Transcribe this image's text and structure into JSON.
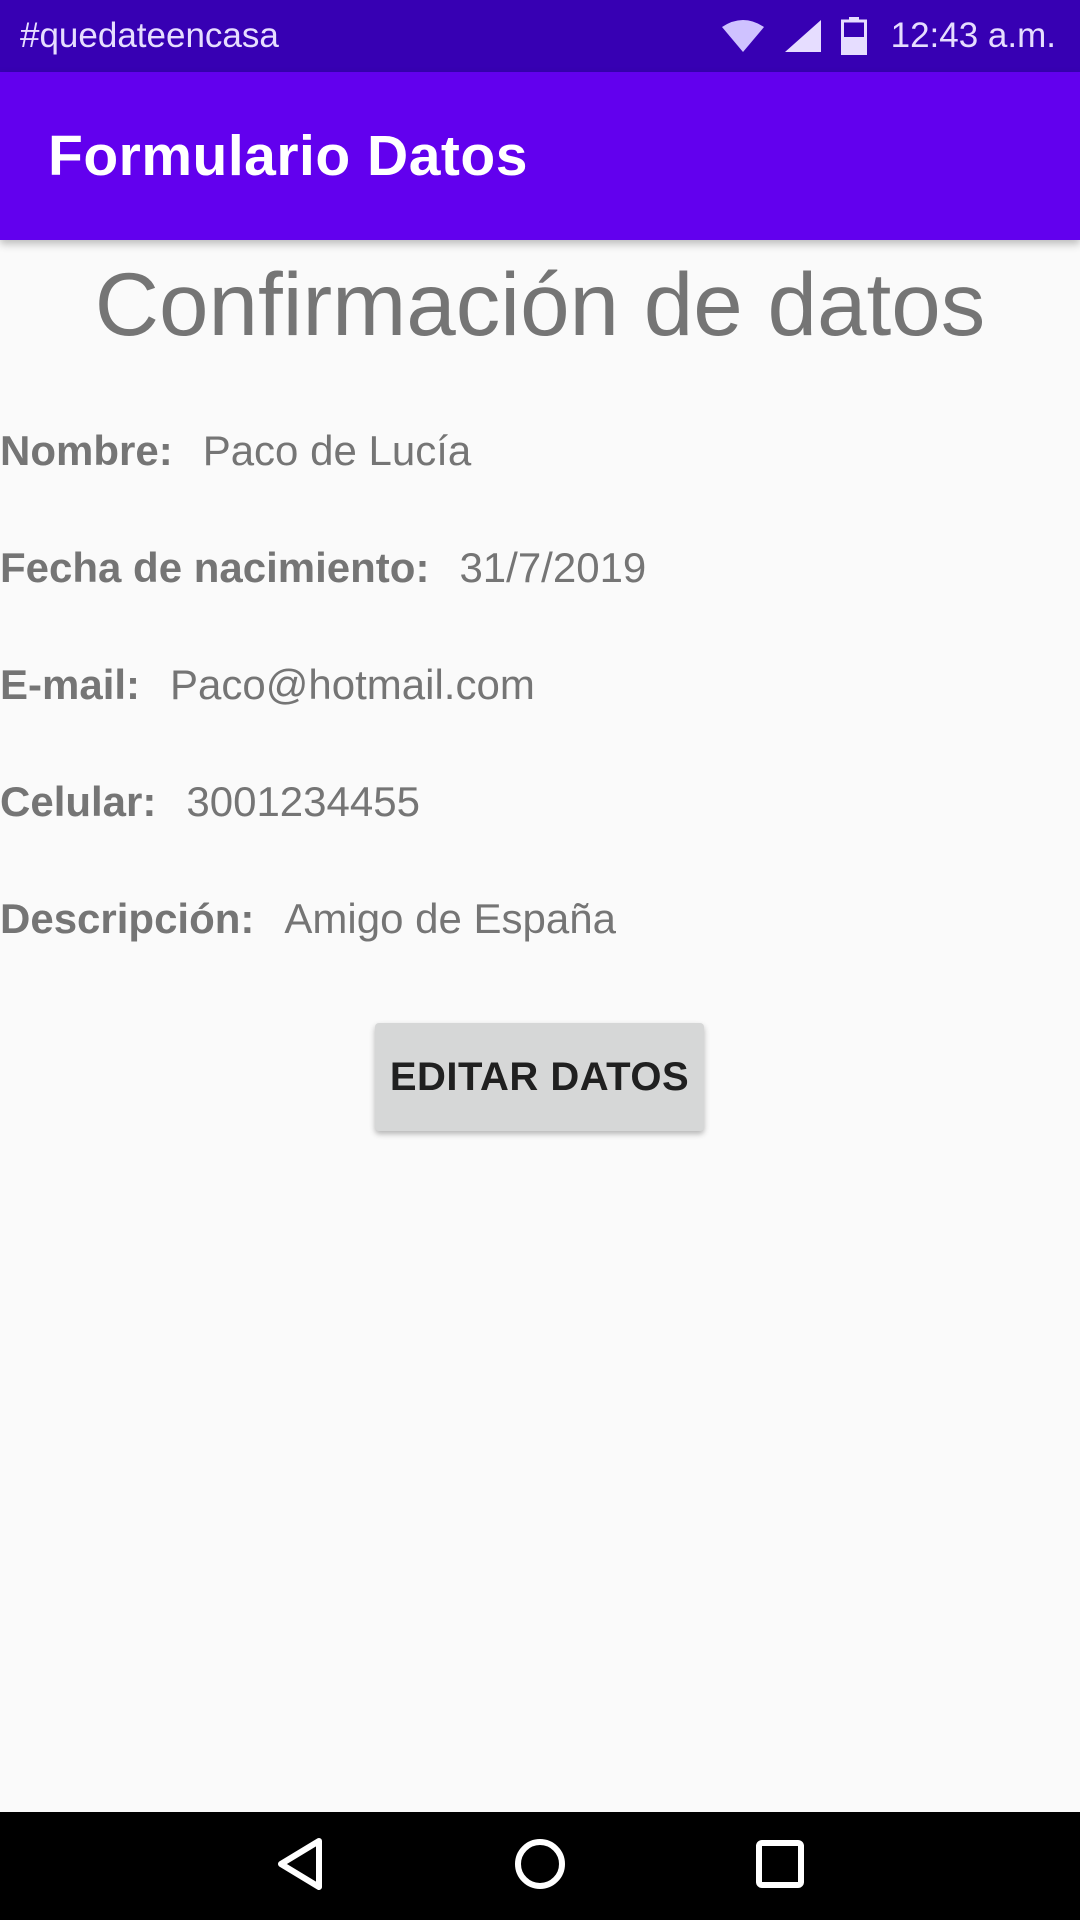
{
  "status_bar": {
    "notification_text": "#quedateencasa",
    "time": "12:43 a.m.",
    "icons": [
      "wifi-icon",
      "cell-signal-icon",
      "battery-icon"
    ]
  },
  "app_bar": {
    "title": "Formulario Datos"
  },
  "content": {
    "heading": "Confirmación de datos",
    "fields": [
      {
        "label": "Nombre:",
        "value": "Paco de Lucía"
      },
      {
        "label": "Fecha de nacimiento:",
        "value": "31/7/2019"
      },
      {
        "label": "E-mail:",
        "value": "Paco@hotmail.com"
      },
      {
        "label": "Celular:",
        "value": "3001234455"
      },
      {
        "label": "Descripción:",
        "value": "Amigo de España"
      }
    ],
    "edit_button_label": "EDITAR DATOS"
  },
  "nav_bar": {
    "icons": [
      "back-icon",
      "home-icon",
      "recents-icon"
    ]
  },
  "colors": {
    "status_bar": "#3700b3",
    "app_bar": "#6200ee",
    "background": "#fafafa",
    "text_gray": "#757575",
    "button_bg": "#d6d7d7"
  }
}
